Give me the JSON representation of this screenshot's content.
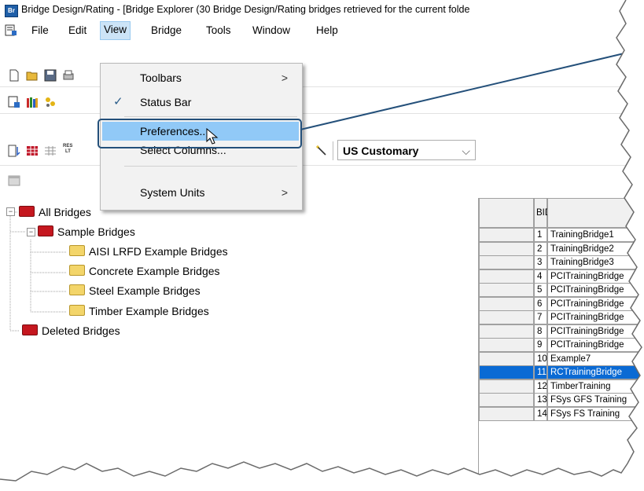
{
  "window": {
    "app_icon_text": "Br",
    "title": "Bridge Design/Rating - [Bridge Explorer (30 Bridge Design/Rating bridges retrieved for the current folde"
  },
  "menubar": {
    "items": [
      "File",
      "Edit",
      "View",
      "Bridge",
      "Tools",
      "Window",
      "Help"
    ],
    "active": "View"
  },
  "view_menu": {
    "items": [
      {
        "label": "Toolbars",
        "submenu": true,
        "checked": false
      },
      {
        "label": "Status Bar",
        "submenu": false,
        "checked": true
      },
      {
        "label": "Preferences...",
        "submenu": false,
        "checked": false,
        "highlighted": true
      },
      {
        "label": "Select Columns...",
        "submenu": false,
        "checked": false
      },
      {
        "label": "System Units",
        "submenu": true,
        "checked": false
      }
    ],
    "submenu_glyph": ">",
    "check_glyph": "✓"
  },
  "toolbar": {
    "units_value": "US Customary",
    "mini_label_1": "RES",
    "mini_label_2": "LT"
  },
  "tree": {
    "root": "All Bridges",
    "sample": "Sample Bridges",
    "children": [
      "AISI LRFD Example Bridges",
      "Concrete Example Bridges",
      "Steel Example Bridges",
      "Timber Example Bridges"
    ],
    "deleted": "Deleted Bridges",
    "collapse_glyph": "−"
  },
  "grid": {
    "header_bid": "BID",
    "rows": [
      {
        "bid": "1",
        "name": "TrainingBridge1"
      },
      {
        "bid": "2",
        "name": "TrainingBridge2"
      },
      {
        "bid": "3",
        "name": "TrainingBridge3"
      },
      {
        "bid": "4",
        "name": "PCITrainingBridge"
      },
      {
        "bid": "5",
        "name": "PCITrainingBridge"
      },
      {
        "bid": "6",
        "name": "PCITrainingBridge"
      },
      {
        "bid": "7",
        "name": "PCITrainingBridge"
      },
      {
        "bid": "8",
        "name": "PCITrainingBridge"
      },
      {
        "bid": "9",
        "name": "PCITrainingBridge"
      },
      {
        "bid": "10",
        "name": "Example7"
      },
      {
        "bid": "11",
        "name": "RCTrainingBridge"
      },
      {
        "bid": "12",
        "name": "TimberTraining"
      },
      {
        "bid": "13",
        "name": "FSys GFS Training"
      },
      {
        "bid": "14",
        "name": "FSys FS Training"
      }
    ],
    "selected_bid": "11"
  },
  "colors": {
    "menu_highlight": "#91c9f7",
    "callout": "#24507a",
    "selection": "#0a6ad4",
    "folder_red": "#c5171f",
    "folder_yellow": "#f3d56a"
  }
}
